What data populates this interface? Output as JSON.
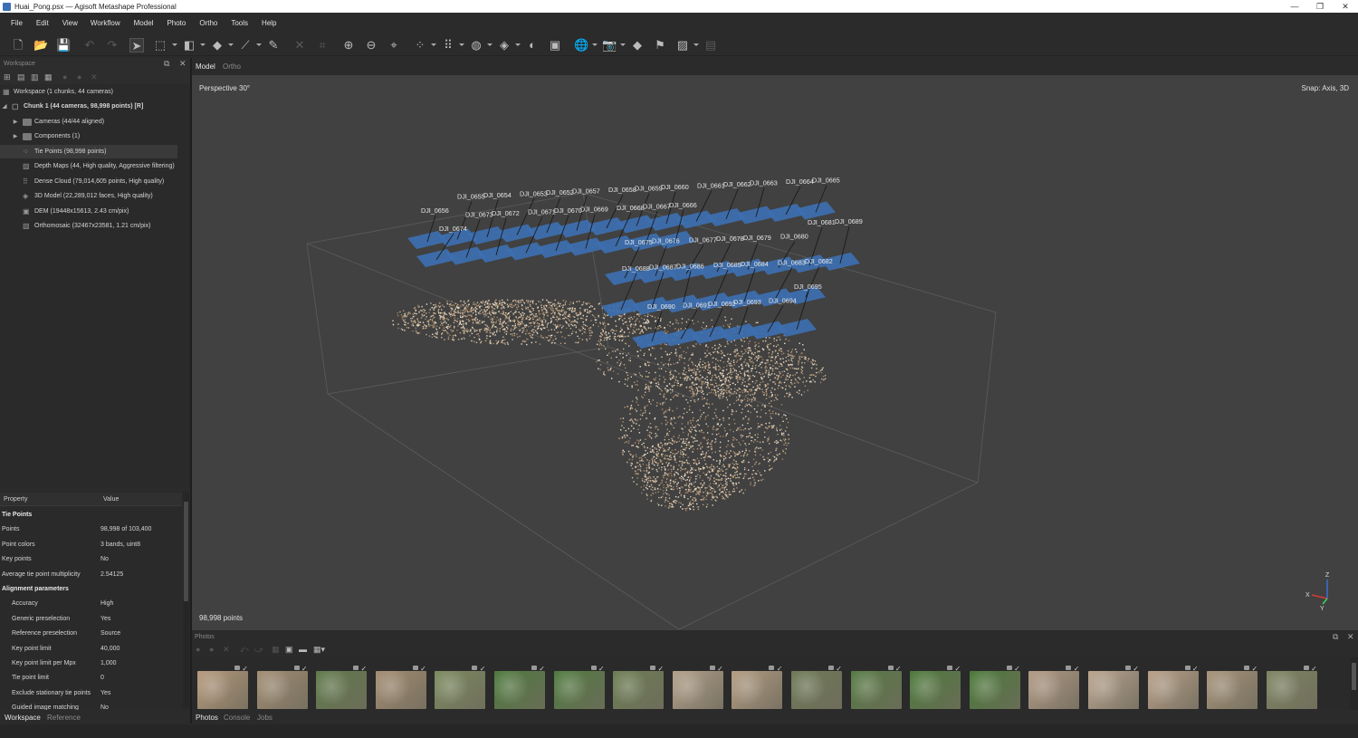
{
  "window": {
    "title": "Huai_Pong.psx — Agisoft Metashape Professional",
    "controls": [
      "—",
      "❐",
      "✕"
    ]
  },
  "menu": [
    "File",
    "Edit",
    "View",
    "Workflow",
    "Model",
    "Photo",
    "Ortho",
    "Tools",
    "Help"
  ],
  "workspace": {
    "panel_title": "Workspace",
    "tree": [
      {
        "label": "Workspace (1 chunks, 44 cameras)",
        "icon": "workspace-icon"
      },
      {
        "label": "Chunk 1 (44 cameras, 98,998 points) [R]",
        "icon": "chunk-icon",
        "bold": true
      },
      {
        "label": "Cameras (44/44 aligned)",
        "icon": "folder-icon"
      },
      {
        "label": "Components (1)",
        "icon": "folder-icon"
      },
      {
        "label": "Tie Points (98,998 points)",
        "icon": "tie-points-icon"
      },
      {
        "label": "Depth Maps (44, High quality, Aggressive filtering)",
        "icon": "depth-maps-icon"
      },
      {
        "label": "Dense Cloud (79,014,605 points, High quality)",
        "icon": "dense-cloud-icon"
      },
      {
        "label": "3D Model (22,289,012 faces, High quality)",
        "icon": "model-icon"
      },
      {
        "label": "DEM (19448x15613, 2.43 cm/pix)",
        "icon": "dem-icon"
      },
      {
        "label": "Orthomosaic (32467x23581, 1.21 cm/pix)",
        "icon": "orthomosaic-icon"
      }
    ]
  },
  "properties": {
    "col_property": "Property",
    "col_value": "Value",
    "rows": [
      {
        "k": "Tie Points",
        "v": "",
        "bold": true
      },
      {
        "k": "Points",
        "v": "98,998 of 103,400"
      },
      {
        "k": "Point colors",
        "v": "3 bands, uint8"
      },
      {
        "k": "Key points",
        "v": "No"
      },
      {
        "k": "Average tie point multiplicity",
        "v": "2.54125"
      },
      {
        "k": "Alignment parameters",
        "v": "",
        "bold": true
      },
      {
        "k": "Accuracy",
        "v": "High",
        "indent": true
      },
      {
        "k": "Generic preselection",
        "v": "Yes",
        "indent": true
      },
      {
        "k": "Reference preselection",
        "v": "Source",
        "indent": true
      },
      {
        "k": "Key point limit",
        "v": "40,000",
        "indent": true
      },
      {
        "k": "Key point limit per Mpx",
        "v": "1,000",
        "indent": true
      },
      {
        "k": "Tie point limit",
        "v": "0",
        "indent": true
      },
      {
        "k": "Exclude stationary tie points",
        "v": "Yes",
        "indent": true
      },
      {
        "k": "Guided image matching",
        "v": "No",
        "indent": true
      }
    ]
  },
  "left_tabs": [
    "Workspace",
    "Reference"
  ],
  "view_tabs": [
    "Model",
    "Ortho"
  ],
  "viewport": {
    "projection": "Perspective 30°",
    "snap": "Snap: Axis, 3D",
    "point_count": "98,998 points",
    "axis_labels": {
      "x": "X",
      "y": "Y",
      "z": "Z"
    },
    "cameras": [
      "DJI_0656",
      "DJI_0655",
      "DJI_0654",
      "DJI_0653",
      "DJI_0652",
      "DJI_0657",
      "DJI_0658",
      "DJI_0659",
      "DJI_0660",
      "DJI_0661",
      "DJI_0662",
      "DJI_0663",
      "DJI_0664",
      "DJI_0665",
      "DJI_0674",
      "DJI_0673",
      "DJI_0672",
      "DJI_0671",
      "DJI_0670",
      "DJI_0669",
      "DJI_0668",
      "DJI_0667",
      "DJI_0666",
      "DJI_0675",
      "DJI_0676",
      "DJI_0677",
      "DJI_0678",
      "DJI_0679",
      "DJI_0680",
      "DJI_0681",
      "DJI_0689",
      "DJI_0688",
      "DJI_0687",
      "DJI_0686",
      "DJI_0685",
      "DJI_0684",
      "DJI_0683",
      "DJI_0682",
      "DJI_0690",
      "DJI_0691",
      "DJI_0692",
      "DJI_0693",
      "DJI_0694",
      "DJI_0695"
    ]
  },
  "photos": {
    "panel_title": "Photos",
    "thumb_colors": [
      "#b79a7c",
      "#a38e74",
      "#5f7a4a",
      "#a48d72",
      "#7b8a5e",
      "#4d7a3c",
      "#4f7a3e",
      "#6c7d52",
      "#b2a089",
      "#b39c82",
      "#6e7a56",
      "#557a42",
      "#4c7a3a",
      "#4a7a38",
      "#b39a85",
      "#bba58f",
      "#b8a088",
      "#a7947a",
      "#7e8561"
    ]
  },
  "bottom_tabs": [
    "Photos",
    "Console",
    "Jobs"
  ],
  "colors": {
    "camera_plane": "#3d6fb0",
    "accent": "#2f63a8"
  }
}
